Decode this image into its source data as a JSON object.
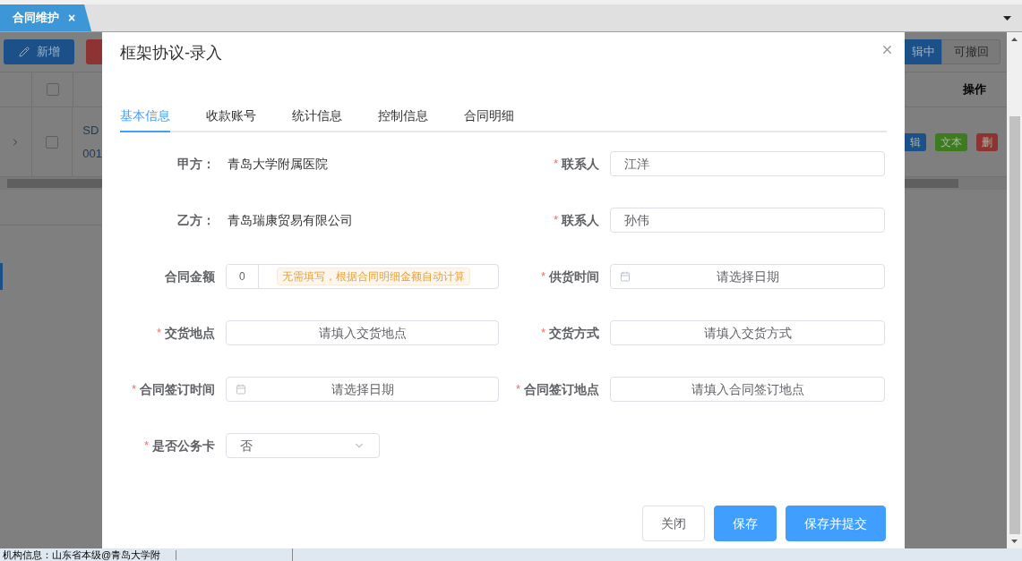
{
  "tab_bar": {
    "tabs": [
      {
        "label": "合同维护",
        "close": "×",
        "selected": true
      }
    ]
  },
  "background": {
    "add_button": "新增",
    "table": {
      "header_checked": false,
      "rows": [
        {
          "checked": false,
          "cells": [
            "SD",
            "001"
          ]
        }
      ]
    },
    "segmented": [
      {
        "label": "辑中",
        "selected": true
      },
      {
        "label": "可撤回",
        "selected": false
      }
    ],
    "action_header": "操作",
    "row_actions": [
      {
        "label": "辑",
        "color": "#1c5088"
      },
      {
        "label": "文本",
        "color": "#3e7a20"
      },
      {
        "label": "删",
        "color": "#8e3333"
      }
    ]
  },
  "modal": {
    "title": "框架协议-录入",
    "tabs": [
      {
        "label": "基本信息",
        "selected": true
      },
      {
        "label": "收款账号",
        "selected": false
      },
      {
        "label": "统计信息",
        "selected": false
      },
      {
        "label": "控制信息",
        "selected": false
      },
      {
        "label": "合同明细",
        "selected": false
      }
    ],
    "rows": [
      [
        {
          "label": "甲方：",
          "kind": "text",
          "value": "青岛大学附属医院"
        },
        {
          "asterisk": "*",
          "label": "联系人",
          "kind": "input",
          "value": "江洋"
        }
      ],
      [
        {
          "label": "乙方：",
          "kind": "text",
          "value": "青岛瑞康贸易有限公司"
        },
        {
          "asterisk": "*",
          "label": "联系人",
          "kind": "input",
          "value": "孙伟"
        }
      ],
      [
        {
          "label": "合同金额",
          "kind": "amount",
          "value": "0",
          "note": "无需填写，根据合同明细金额自动计算"
        },
        {
          "asterisk": "*",
          "label": "供货时间",
          "kind": "date",
          "placeholder": "请选择日期"
        }
      ],
      [
        {
          "asterisk": "*",
          "label": "交货地点",
          "kind": "input",
          "placeholder": "请填入交货地点"
        },
        {
          "asterisk": "*",
          "label": "交货方式",
          "kind": "input",
          "placeholder": "请填入交货方式"
        }
      ],
      [
        {
          "asterisk": "*",
          "label": "合同签订时间",
          "kind": "date",
          "placeholder": "请选择日期"
        },
        {
          "asterisk": "*",
          "label": "合同签订地点",
          "kind": "input",
          "placeholder": "请填入合同签订地点"
        }
      ],
      [
        {
          "asterisk": "*",
          "label": "是否公务卡",
          "kind": "select",
          "value": "否"
        }
      ]
    ],
    "buttons": [
      {
        "label": "关闭",
        "kind": "default"
      },
      {
        "label": "保存",
        "kind": "primary"
      },
      {
        "label": "保存并提交",
        "kind": "primary"
      }
    ]
  },
  "status_bar": {
    "text": "机构信息：山东省本级@青岛大学附"
  }
}
